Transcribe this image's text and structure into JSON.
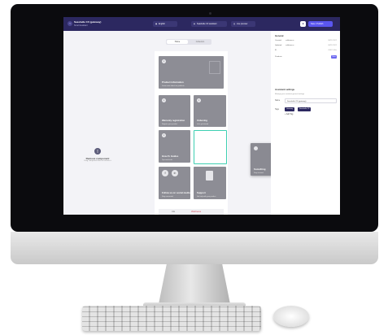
{
  "topbar": {
    "project_title": "Seashelle CF (gateway)",
    "project_subtitle": "Smart Assistant",
    "language": "English",
    "selected_assistant": "Seashelle CF assistant",
    "live_preview": "Live preview",
    "publish_label": "Save / Publish"
  },
  "canvas": {
    "toggle": {
      "home": "Home",
      "collection": "Collection"
    },
    "remove_title": "Remove component",
    "remove_sub": "Drag component here to remove it",
    "tiles": [
      {
        "title": "Product information",
        "subtitle": "Learn more about our products"
      },
      {
        "title": "Warranty registration",
        "subtitle": "Register your product"
      },
      {
        "title": "Unboxing",
        "subtitle": "Let's get started"
      },
      {
        "title": "How-To Guides",
        "subtitle": "Tips and tricks"
      },
      {
        "title": "Follow us on social media",
        "subtitle": "Stay connected"
      },
      {
        "title": "Support",
        "subtitle": "Get help with your product"
      }
    ],
    "drag_tile": {
      "title": "Something",
      "subtitle": "Drop to insert"
    },
    "bottom_items": [
      "CE",
      "Wellness"
    ]
  },
  "panel": {
    "general_title": "General",
    "rows": [
      {
        "key": "Created",
        "value": "caffeineco...",
        "date": "09/11/2022"
      },
      {
        "key": "Updated",
        "value": "caffeineco...",
        "date": "09/11/2022"
      },
      {
        "key": "ID",
        "value": "",
        "date": "6542-1d5e"
      },
      {
        "key": "Products",
        "value": "",
        "date": ""
      }
    ],
    "preview_label": "View",
    "assistant_title": "Assistant settings",
    "assistant_desc": "Manage your assistant general settings",
    "name_label": "Name",
    "name_value": "Seashelle CF (gateway)",
    "tags_label": "Tags",
    "tags": [
      "Gateway",
      "Seashelle CF"
    ],
    "add_tag": "+ Add Tag"
  },
  "colors": {
    "topbar": "#2c2860",
    "accent": "#5a56f0",
    "highlight": "#3ecfb2",
    "tile": "#8d8d95"
  }
}
